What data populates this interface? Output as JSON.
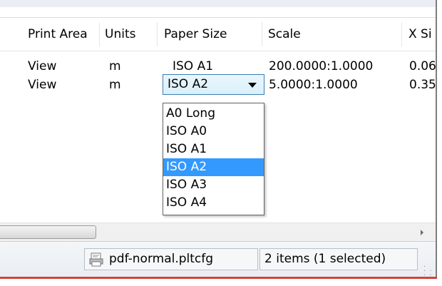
{
  "columns": [
    "Print Area",
    "Units",
    "Paper Size",
    "Scale",
    "X Si"
  ],
  "rows": [
    {
      "print_area": "View",
      "units": "m",
      "paper_size": "ISO A1",
      "scale": "200.0000:1.0000",
      "x_size": "0.06"
    },
    {
      "print_area": "View",
      "units": "m",
      "paper_size": "ISO A2",
      "scale": "5.0000:1.0000",
      "x_size": "0.35"
    }
  ],
  "paper_size_options": [
    "A0 Long",
    "ISO A0",
    "ISO A1",
    "ISO A2",
    "ISO A3",
    "ISO A4"
  ],
  "selected_option": "ISO A2",
  "status": {
    "config_file": "pdf-normal.pltcfg",
    "selection_summary": "2 items (1 selected)"
  },
  "colors": {
    "selection": "#3399ff",
    "bottom_accent": "#d6403a"
  }
}
